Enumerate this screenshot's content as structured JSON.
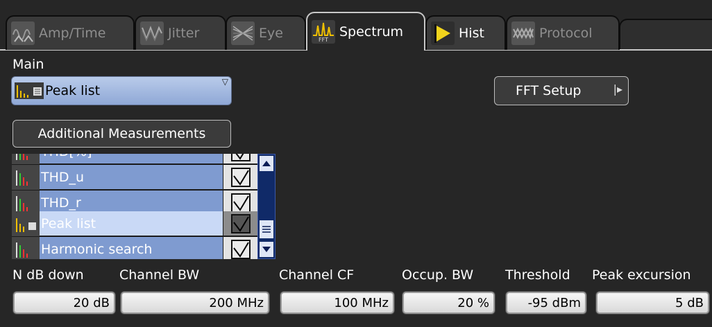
{
  "tabs": [
    {
      "label": "Amp/Time",
      "icon": "amp-time-icon",
      "active": false
    },
    {
      "label": "Jitter",
      "icon": "jitter-icon",
      "active": false
    },
    {
      "label": "Eye",
      "icon": "eye-diagram-icon",
      "active": false
    },
    {
      "label": "Spectrum",
      "icon": "fft-spectrum-icon",
      "active": true
    },
    {
      "label": "Hist",
      "icon": "histogram-flag-icon",
      "active": false
    },
    {
      "label": "Protocol",
      "icon": "protocol-icon",
      "active": false
    }
  ],
  "fft_icon_caption": "FFT",
  "main": {
    "label": "Main",
    "selected": "Peak list",
    "fft_setup_label": "FFT Setup",
    "additional_label": "Additional Measurements"
  },
  "measurements": [
    {
      "name": "THD[%]",
      "checked": true,
      "selected": false
    },
    {
      "name": "THD_u",
      "checked": true,
      "selected": false
    },
    {
      "name": "THD_r",
      "checked": true,
      "selected": false
    },
    {
      "name": "Peak list",
      "checked": true,
      "selected": true
    },
    {
      "name": "Harmonic search",
      "checked": true,
      "selected": false
    }
  ],
  "params": [
    {
      "label": "N dB down",
      "value": "20 dB"
    },
    {
      "label": "Channel BW",
      "value": "200 MHz"
    },
    {
      "label": "Channel CF",
      "value": "100 MHz"
    },
    {
      "label": "Occup. BW",
      "value": "20 %"
    },
    {
      "label": "Threshold",
      "value": "-95 dBm"
    },
    {
      "label": "Peak excursion",
      "value": "5 dB"
    }
  ],
  "colors": {
    "background": "#262626",
    "list_row": "#7f9bd0",
    "list_row_selected": "#c9d9f6",
    "scrollbar": "#102a68",
    "hist_flag": "#f2d41c"
  }
}
